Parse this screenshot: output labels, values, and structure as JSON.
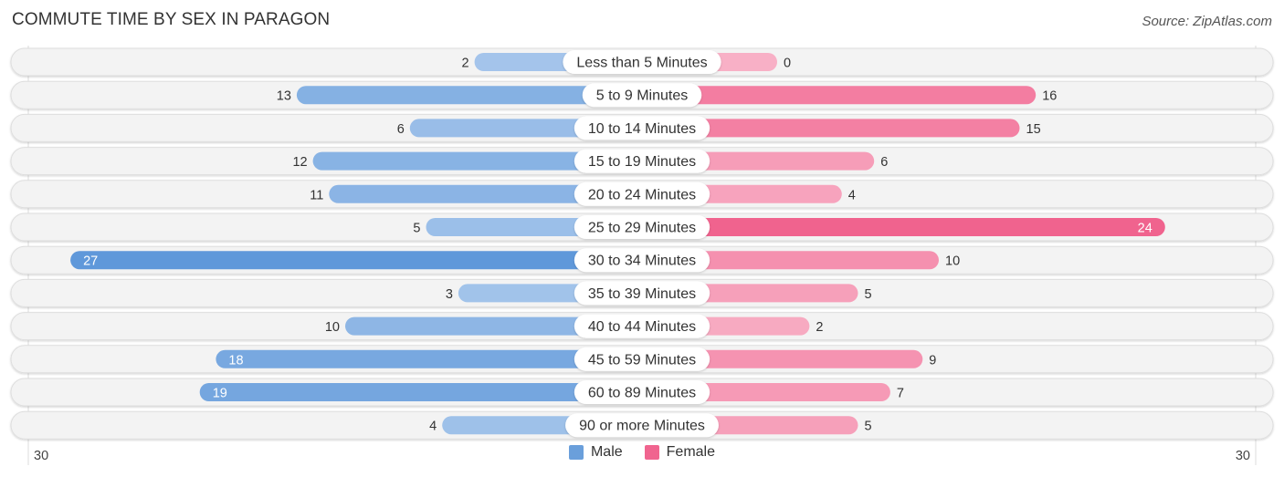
{
  "chart_data": {
    "type": "bar",
    "orientation": "horizontal-diverging",
    "title": "COMMUTE TIME BY SEX IN PARAGON",
    "source": "Source: ZipAtlas.com",
    "categories": [
      "Less than 5 Minutes",
      "5 to 9 Minutes",
      "10 to 14 Minutes",
      "15 to 19 Minutes",
      "20 to 24 Minutes",
      "25 to 29 Minutes",
      "30 to 34 Minutes",
      "35 to 39 Minutes",
      "40 to 44 Minutes",
      "45 to 59 Minutes",
      "60 to 89 Minutes",
      "90 or more Minutes"
    ],
    "series": [
      {
        "name": "Male",
        "color": "#6a9fdb",
        "values": [
          2,
          13,
          6,
          12,
          11,
          5,
          27,
          3,
          10,
          18,
          19,
          4
        ]
      },
      {
        "name": "Female",
        "color": "#f0648f",
        "values": [
          0,
          16,
          15,
          6,
          4,
          24,
          10,
          5,
          2,
          9,
          7,
          5
        ]
      }
    ],
    "axis": {
      "left_label": "30",
      "right_label": "30",
      "max": 30
    },
    "legend": {
      "position": "bottom-center",
      "items": [
        "Male",
        "Female"
      ]
    }
  }
}
